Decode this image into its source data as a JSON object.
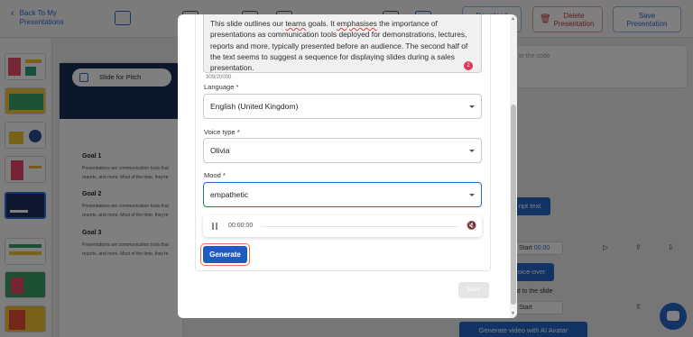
{
  "header": {
    "back_label_line1": "Back To My",
    "back_label_line2": "Presentations",
    "download_label": "Download",
    "delete_label_line1": "Delete",
    "delete_label_line2": "Presentation",
    "save_label_line1": "Save",
    "save_label_line2": "Presentation"
  },
  "slide": {
    "pitch_label": "Slide for Pitch",
    "goals": [
      {
        "title": "Goal 1",
        "line1": "Presentations are communication tools that",
        "line2": "reports, and more. Most of the time, they're"
      },
      {
        "title": "Goal 2",
        "line1": "Presentations are communication tools that",
        "line2": "reports, and more. Most of the time, they're"
      },
      {
        "title": "Goal 3",
        "line1": "Presentations are communication tools that",
        "line2": "reports, and more. Most of the time, they're"
      }
    ]
  },
  "right_panel": {
    "notes_placeholder": "te the code",
    "script_text_btn": "ript text",
    "start_label": "Start",
    "start_time": "00:00",
    "voice_over_btn": "oice-over",
    "added_note": "ded to the slide",
    "start2_label": "Start",
    "avatar_btn": "Generate video with AI Avatar"
  },
  "modal": {
    "script_part1": "This slide outlines our ",
    "script_word_teams": "teams",
    "script_part2": " goals. It ",
    "script_word_emphasises": "emphasises",
    "script_part3": " the importance of presentations as communication tools deployed for demonstrations, lectures, reports and more, typically presented before an audience. The second half of the text seems to suggest a sequence for displaying slides during a sales presentation.",
    "error_badge": "2",
    "char_count": "309/20000",
    "language_label": "Language *",
    "language_value": "English (United Kingdom)",
    "voice_label": "Voice type *",
    "voice_value": "Olivia",
    "mood_label": "Mood *",
    "mood_value": "empathetic",
    "player_time": "00:00:00",
    "generate_label": "Generate",
    "save_label": "Save"
  },
  "colors": {
    "accent": "#1f5bc4",
    "error": "#e0345a",
    "overlay": "rgba(0,0,0,0.5)"
  }
}
